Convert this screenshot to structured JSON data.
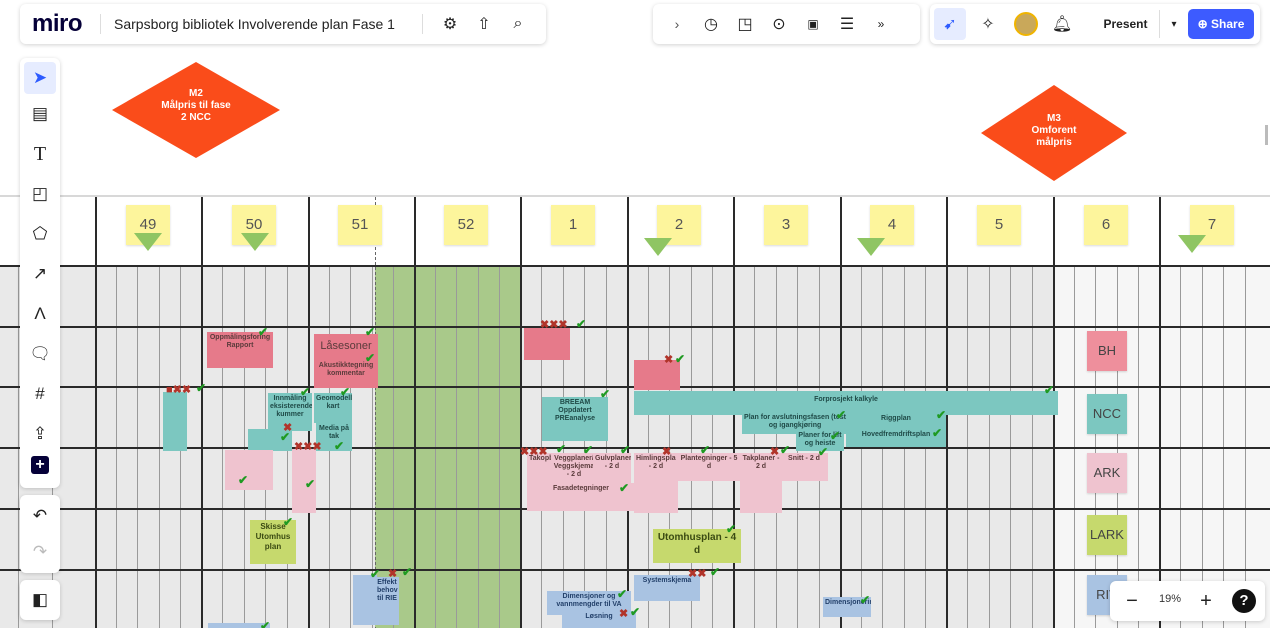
{
  "header": {
    "logo": "miro",
    "board_title": "Sarpsborg bibliotek Involverende plan Fase 1",
    "present_label": "Present",
    "share_label": "Share"
  },
  "icons": {
    "settings": "gear-icon",
    "upload": "upload-icon",
    "search": "search-icon",
    "chevron": "chevron-right-icon",
    "timer": "timer-icon",
    "frame": "frame-icon",
    "focus": "focus-icon",
    "counter": "counter-icon",
    "notes": "notes-icon",
    "more": "more-chevron-icon",
    "cursor": "cursor-icon",
    "reactions": "reactions-icon",
    "bell": "bell-icon"
  },
  "zoom": {
    "value": "19%"
  },
  "milestones": [
    {
      "code": "M2",
      "line1": "Målpris til fase",
      "line2": "2 NCC"
    },
    {
      "code": "M3",
      "line1": "Omforent",
      "line2": "målpris"
    }
  ],
  "weeks": [
    "49",
    "50",
    "51",
    "52",
    "1",
    "2",
    "3",
    "4",
    "5",
    "6",
    "7"
  ],
  "legend": [
    "BH",
    "NCC",
    "ARK",
    "LARK",
    "RIV"
  ],
  "notes": {
    "n1": "Oppmålingsforing Rapport",
    "n2": "Låsesoner",
    "n3": "Akustikktegning kommentar",
    "n4": "Innmåling eksisterende kummer",
    "n5": "Geomodell kart",
    "n6": "Media på tak",
    "n7": "Skisse Utomhus plan",
    "n8": "BREEAM Oppdatert PREanalyse",
    "n9": "Forprosjekt kalkyle",
    "n10": "Plan for avslutningsfasen (test og igangkjøring",
    "n11": "Riggplan",
    "n12": "Hovedfremdriftsplan",
    "n13": "Planer for lift og heiste",
    "n14": "Takopbygning",
    "n15": "Veggplaner/ Veggskjema - 2 d",
    "n16": "Gulvplaner - 2 d",
    "n17": "Himlingsplaner - 2 d",
    "n18": "Plantegninger - 5 d",
    "n19": "Takplaner - 2 d",
    "n20": "Snitt - 2 d",
    "n21": "Fasadetegninger",
    "n22": "Utomhusplan - 4 d",
    "n23": "Systemskjema",
    "n24": "Dimensjoner og vannmengder til VA",
    "n25": "Løsning",
    "n26": "Dimensjonering",
    "n27": "Effekt behov til RIE"
  }
}
